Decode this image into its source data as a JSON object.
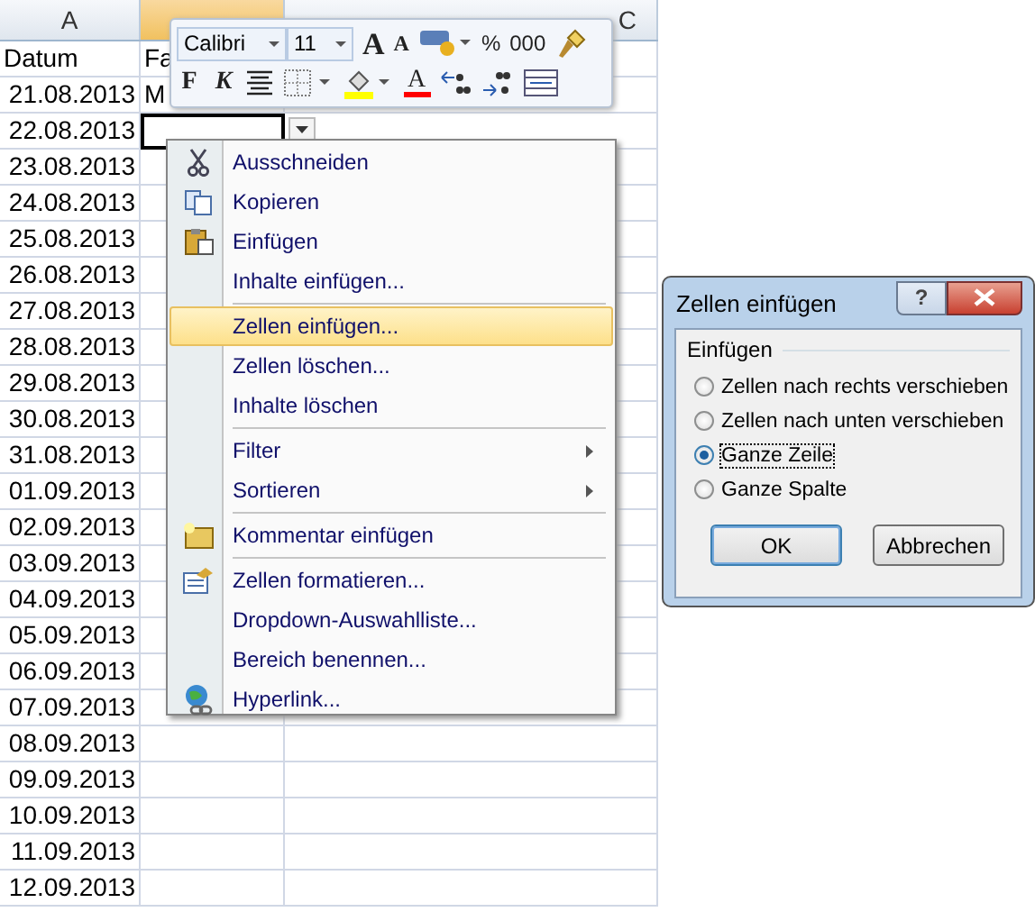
{
  "sheet": {
    "columns": [
      {
        "label": "A",
        "selected": false
      },
      {
        "selected": true
      },
      {
        "label": "C",
        "selected": false
      }
    ],
    "rows": [
      {
        "kind": "label",
        "cells": [
          "Datum",
          "Fa"
        ],
        "active": false
      },
      {
        "kind": "date",
        "cells": [
          "21.08.2013",
          "M"
        ],
        "active": false
      },
      {
        "kind": "date",
        "cells": [
          "22.08.2013"
        ],
        "active": true
      },
      {
        "kind": "date",
        "cells": [
          "23.08.2013"
        ],
        "active": false
      },
      {
        "kind": "date",
        "cells": [
          "24.08.2013"
        ],
        "active": false
      },
      {
        "kind": "date",
        "cells": [
          "25.08.2013"
        ],
        "active": false
      },
      {
        "kind": "date",
        "cells": [
          "26.08.2013"
        ],
        "active": false
      },
      {
        "kind": "date",
        "cells": [
          "27.08.2013"
        ],
        "active": false
      },
      {
        "kind": "date",
        "cells": [
          "28.08.2013"
        ],
        "active": false
      },
      {
        "kind": "date",
        "cells": [
          "29.08.2013"
        ],
        "active": false
      },
      {
        "kind": "date",
        "cells": [
          "30.08.2013"
        ],
        "active": false
      },
      {
        "kind": "date",
        "cells": [
          "31.08.2013"
        ],
        "active": false
      },
      {
        "kind": "date",
        "cells": [
          "01.09.2013"
        ],
        "active": false
      },
      {
        "kind": "date",
        "cells": [
          "02.09.2013"
        ],
        "active": false
      },
      {
        "kind": "date",
        "cells": [
          "03.09.2013"
        ],
        "active": false
      },
      {
        "kind": "date",
        "cells": [
          "04.09.2013"
        ],
        "active": false
      },
      {
        "kind": "date",
        "cells": [
          "05.09.2013"
        ],
        "active": false
      },
      {
        "kind": "date",
        "cells": [
          "06.09.2013"
        ],
        "active": false
      },
      {
        "kind": "date",
        "cells": [
          "07.09.2013"
        ],
        "active": false
      },
      {
        "kind": "date",
        "cells": [
          "08.09.2013"
        ],
        "active": false
      },
      {
        "kind": "date",
        "cells": [
          "09.09.2013"
        ],
        "active": false
      },
      {
        "kind": "date",
        "cells": [
          "10.09.2013"
        ],
        "active": false
      },
      {
        "kind": "date",
        "cells": [
          "11.09.2013"
        ],
        "active": false
      },
      {
        "kind": "date",
        "cells": [
          "12.09.2013"
        ],
        "active": false
      }
    ]
  },
  "mini_toolbar": {
    "font": "Calibri",
    "size": "11",
    "row1": [
      {
        "kind": "grow",
        "label": "A"
      },
      {
        "kind": "shrink",
        "label": "A"
      },
      {
        "kind": "accounting"
      },
      {
        "kind": "text",
        "label": "%"
      },
      {
        "kind": "text",
        "label": "000"
      },
      {
        "kind": "painter"
      }
    ],
    "row2": [
      {
        "kind": "bold",
        "label": "F"
      },
      {
        "kind": "italic",
        "label": "K"
      },
      {
        "kind": "center"
      },
      {
        "kind": "borders"
      },
      {
        "kind": "fill",
        "color": "#ffff00"
      },
      {
        "kind": "fontcolor",
        "label": "A",
        "color": "#ff0000"
      },
      {
        "kind": "incdec"
      },
      {
        "kind": "decdec"
      },
      {
        "kind": "merge"
      }
    ]
  },
  "context_menu": [
    {
      "kind": "item",
      "label": "Ausschneiden",
      "selected": false
    },
    {
      "kind": "item",
      "label": "Kopieren",
      "selected": false
    },
    {
      "kind": "item",
      "label": "Einfügen",
      "selected": false
    },
    {
      "kind": "item",
      "label": "Inhalte einfügen...",
      "selected": false
    },
    {
      "kind": "separator"
    },
    {
      "kind": "item",
      "label": "Zellen einfügen...",
      "selected": true
    },
    {
      "kind": "item",
      "label": "Zellen löschen...",
      "selected": false
    },
    {
      "kind": "item",
      "label": "Inhalte löschen",
      "selected": false
    },
    {
      "kind": "separator"
    },
    {
      "kind": "item",
      "label": "Filter",
      "submenu": true,
      "selected": false
    },
    {
      "kind": "item",
      "label": "Sortieren",
      "submenu": true,
      "selected": false
    },
    {
      "kind": "separator"
    },
    {
      "kind": "item",
      "label": "Kommentar einfügen",
      "selected": false
    },
    {
      "kind": "separator"
    },
    {
      "kind": "item",
      "label": "Zellen formatieren...",
      "selected": false
    },
    {
      "kind": "item",
      "label": "Dropdown-Auswahlliste...",
      "selected": false
    },
    {
      "kind": "item",
      "label": "Bereich benennen...",
      "selected": false
    },
    {
      "kind": "item",
      "label": "Hyperlink...",
      "selected": false
    }
  ],
  "dialog": {
    "title": "Zellen einfügen",
    "help": "?",
    "group": "Einfügen",
    "options": [
      {
        "label": "Zellen nach rechts verschieben",
        "selected": false
      },
      {
        "label": "Zellen nach unten verschieben",
        "selected": false
      },
      {
        "label": "Ganze Zeile",
        "selected": true
      },
      {
        "label": "Ganze Spalte",
        "selected": false
      }
    ],
    "buttons": [
      {
        "label": "OK",
        "default": true
      },
      {
        "label": "Abbrechen",
        "default": false
      }
    ]
  }
}
